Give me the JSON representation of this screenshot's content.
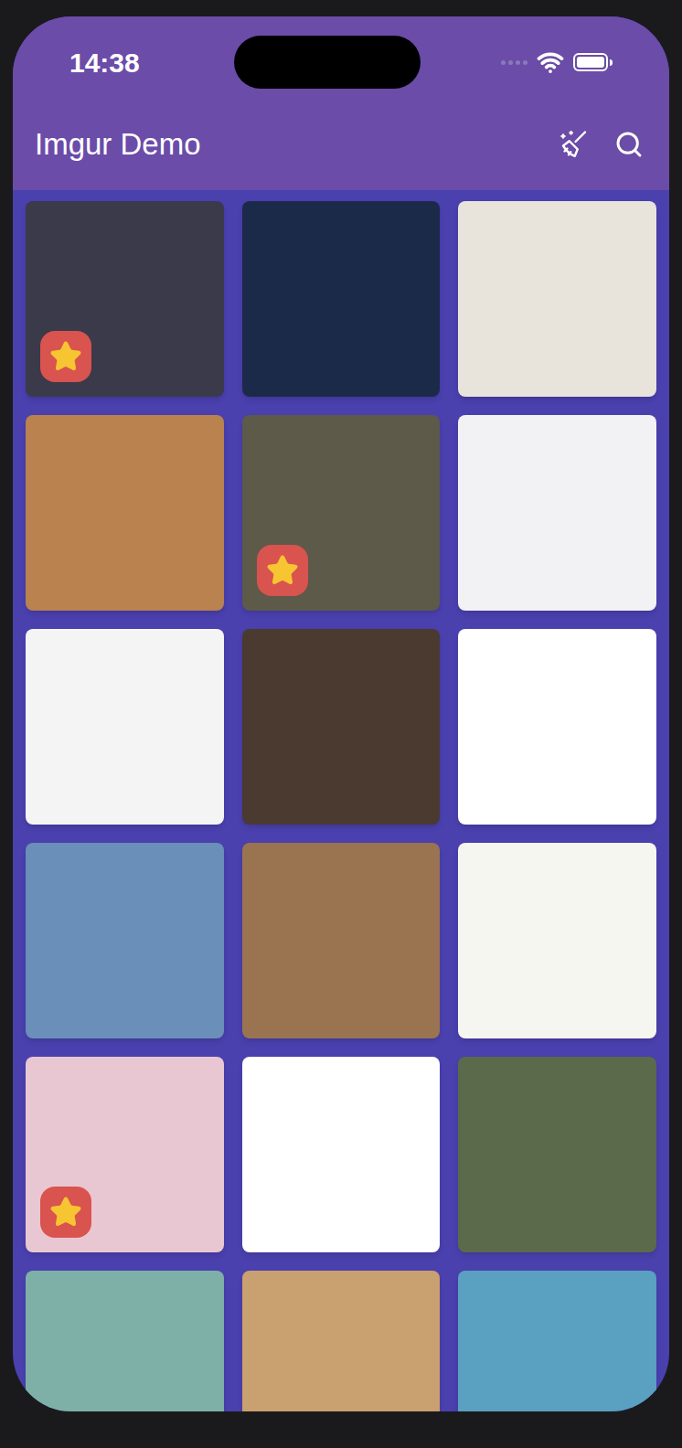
{
  "status_bar": {
    "time": "14:38"
  },
  "app_bar": {
    "title": "Imgur Demo"
  },
  "gallery": {
    "tiles": [
      {
        "favorite": true
      },
      {
        "favorite": false
      },
      {
        "favorite": false
      },
      {
        "favorite": false
      },
      {
        "favorite": true
      },
      {
        "favorite": false
      },
      {
        "favorite": false
      },
      {
        "favorite": false
      },
      {
        "favorite": false
      },
      {
        "favorite": false
      },
      {
        "favorite": false
      },
      {
        "favorite": false
      },
      {
        "favorite": true
      },
      {
        "favorite": false
      },
      {
        "favorite": false
      },
      {
        "favorite": false
      },
      {
        "favorite": false
      },
      {
        "favorite": false
      }
    ]
  }
}
